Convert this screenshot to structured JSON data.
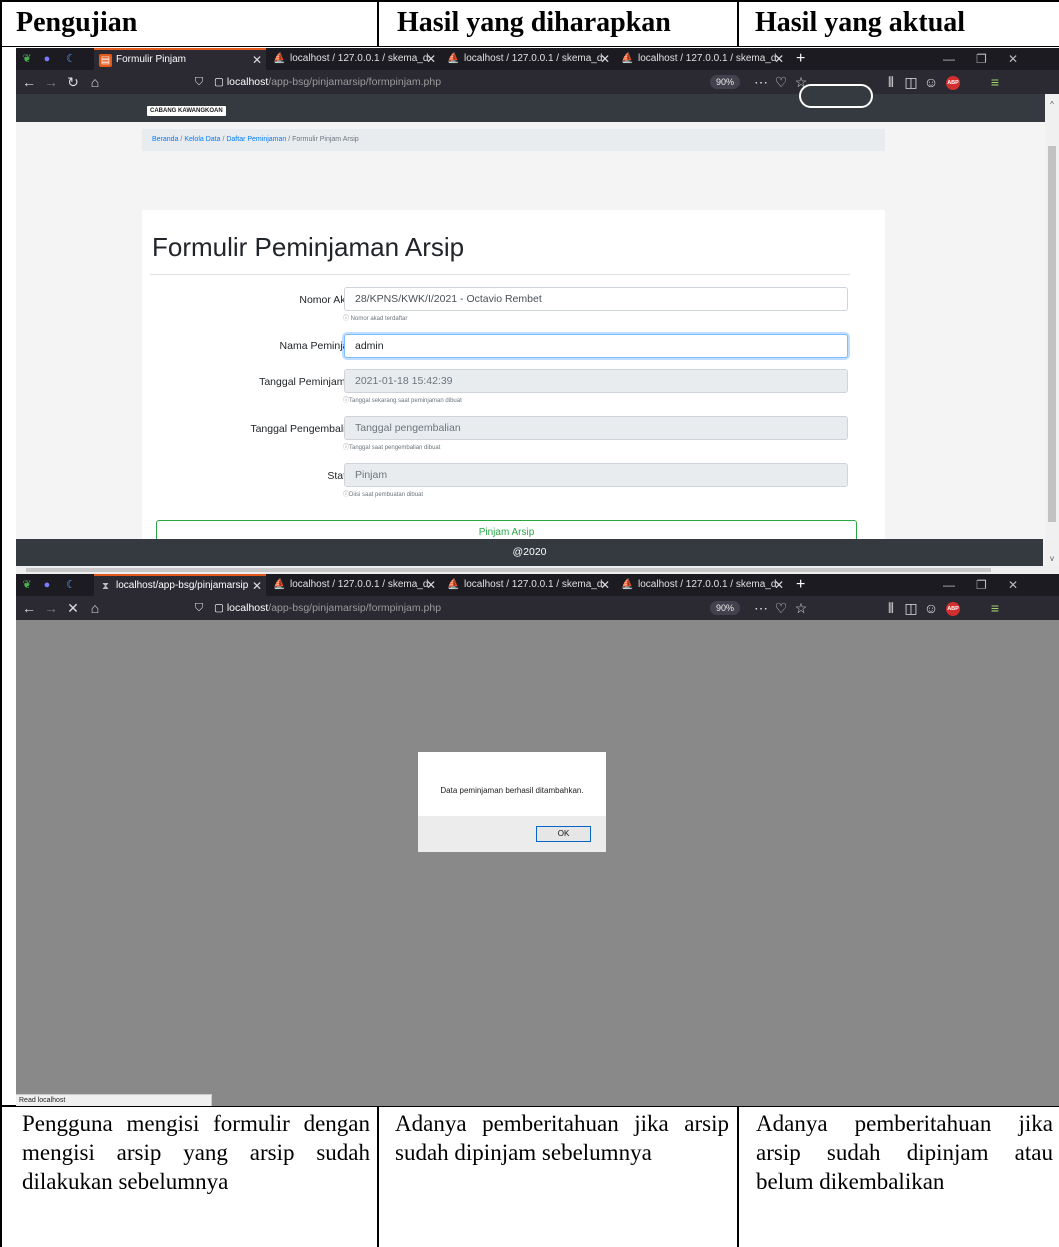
{
  "table": {
    "headers": [
      "Pengujian",
      "Hasil yang diharapkan",
      "Hasil yang aktual"
    ],
    "row": [
      "Pengguna mengisi formulir dengan mengisi arsip yang arsip sudah dilakukan sebelumnya",
      "Adanya pemberitahuan jika arsip sudah dipinjam sebelumnya",
      "Adanya pemberitahuan jika arsip sudah dipinjam atau belum dikembalikan"
    ]
  },
  "browser": {
    "tabs": [
      "Formulir Pinjam",
      "localhost / 127.0.0.1 / skema_d",
      "localhost / 127.0.0.1 / skema_d",
      "localhost / 127.0.0.1 / skema_d"
    ],
    "loading_tab": "localhost/app-bsg/pinjamarsip",
    "url_host": "localhost",
    "url_path": "/app-bsg/pinjamarsip/formpinjam.php",
    "zoom": "90%",
    "adblock": "ABP"
  },
  "page": {
    "logo_text": "CABANG KAWANGKOAN",
    "breadcrumb": [
      "Beranda",
      "Kelola Data",
      "Daftar Peminjaman",
      "Formulir Pinjam Arsip"
    ],
    "title": "Formulir Peminjaman Arsip",
    "fields": [
      {
        "label": "Nomor Akad :",
        "value": "28/KPNS/KWK/I/2021 - Octavio Rembet",
        "help": "ⓘ Nomor akad terdaftar"
      },
      {
        "label": "Nama Peminjam :",
        "value": "admin",
        "help": ""
      },
      {
        "label": "Tanggal Peminjaman :",
        "value": "2021-01-18 15:42:39",
        "help": "ⓘTanggal sekarang saat peminjaman dibuat"
      },
      {
        "label": "Tanggal Pengembalian :",
        "placeholder": "Tanggal pengembalian",
        "help": "ⓘTanggal saat pengembalian dibuat"
      },
      {
        "label": "Status :",
        "value": "Pinjam",
        "help": "ⓘDiisi saat pembuatan dibuat"
      }
    ],
    "submit_label": "Pinjam Arsip",
    "footer": "@2020"
  },
  "alert": {
    "message": "Data peminjaman berhasil ditambahkan.",
    "ok_label": "OK"
  },
  "status_bar": "Read localhost"
}
